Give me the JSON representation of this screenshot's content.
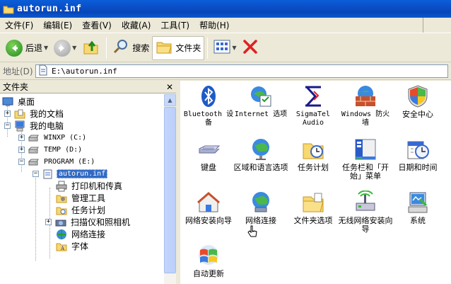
{
  "window": {
    "title": "autorun.inf"
  },
  "menu": [
    "文件(F)",
    "编辑(E)",
    "查看(V)",
    "收藏(A)",
    "工具(T)",
    "帮助(H)"
  ],
  "toolbar": {
    "back": "后退",
    "search": "搜索",
    "folders": "文件夹"
  },
  "address": {
    "label": "地址(D)",
    "value": "E:\\autorun.inf"
  },
  "left_pane": {
    "title": "文件夹",
    "tree": [
      {
        "label": "桌面"
      },
      {
        "label": "我的文档"
      },
      {
        "label": "我的电脑"
      },
      {
        "label": "WINXP (C:)"
      },
      {
        "label": "TEMP (D:)"
      },
      {
        "label": "PROGRAM (E:)"
      },
      {
        "label": "autorun.inf"
      },
      {
        "label": "打印机和传真"
      },
      {
        "label": "管理工具"
      },
      {
        "label": "任务计划"
      },
      {
        "label": "扫描仪和照相机"
      },
      {
        "label": "网络连接"
      },
      {
        "label": "字体"
      }
    ]
  },
  "items": [
    {
      "label": "Bluetooth 设备",
      "icon": "bluetooth-icon"
    },
    {
      "label": "Internet 选项",
      "icon": "internet-options-icon"
    },
    {
      "label": "SigmaTel Audio",
      "icon": "sigmatel-audio-icon"
    },
    {
      "label": "Windows 防火墙",
      "icon": "firewall-icon"
    },
    {
      "label": "安全中心",
      "icon": "security-center-icon"
    },
    {
      "label": "键盘",
      "icon": "keyboard-icon"
    },
    {
      "label": "区域和语言选项",
      "icon": "globe-icon"
    },
    {
      "label": "任务计划",
      "icon": "scheduled-tasks-icon"
    },
    {
      "label": "任务栏和「开始」菜单",
      "icon": "taskbar-icon"
    },
    {
      "label": "日期和时间",
      "icon": "clock-icon"
    },
    {
      "label": "网络安装向导",
      "icon": "network-setup-icon"
    },
    {
      "label": "网络连接",
      "icon": "network-connections-icon"
    },
    {
      "label": "文件夹选项",
      "icon": "folder-options-icon"
    },
    {
      "label": "无线网络安装向导",
      "icon": "wireless-icon"
    },
    {
      "label": "系统",
      "icon": "system-icon"
    },
    {
      "label": "自动更新",
      "icon": "windows-update-icon"
    }
  ]
}
